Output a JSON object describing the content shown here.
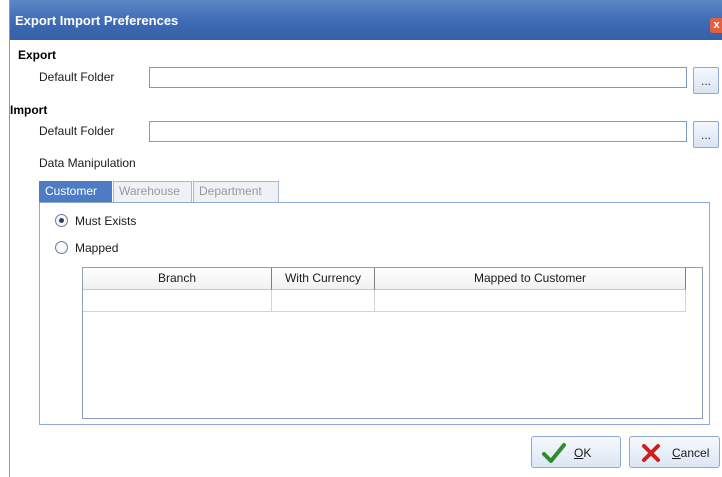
{
  "window": {
    "title": "Export Import Preferences",
    "close_glyph": "x"
  },
  "export": {
    "heading": "Export",
    "default_folder_label": "Default Folder",
    "default_folder_value": "",
    "browse_label": "..."
  },
  "import": {
    "heading": "Import",
    "default_folder_label": "Default Folder",
    "default_folder_value": "",
    "browse_label": "..."
  },
  "data_manipulation": {
    "label": "Data Manipulation",
    "tabs": [
      {
        "label": "Customer",
        "active": true
      },
      {
        "label": "Warehouse",
        "active": false
      },
      {
        "label": "Department",
        "active": false
      }
    ],
    "options": [
      {
        "label": "Must Exists",
        "checked": true
      },
      {
        "label": "Mapped",
        "checked": false
      }
    ],
    "grid": {
      "columns": [
        "Branch",
        "With Currency",
        "Mapped to Customer"
      ],
      "rows": [
        [
          "",
          "",
          ""
        ]
      ]
    }
  },
  "buttons": {
    "ok": {
      "mnemonic": "O",
      "rest": "K",
      "icon": "check-icon",
      "icon_color": "#2e8b2e"
    },
    "cancel": {
      "mnemonic": "C",
      "rest": "ancel",
      "icon": "x-icon",
      "icon_color": "#cc1f1f"
    }
  },
  "colors": {
    "titlebar": "#3d6bb5",
    "active_tab": "#4d7cc4"
  }
}
